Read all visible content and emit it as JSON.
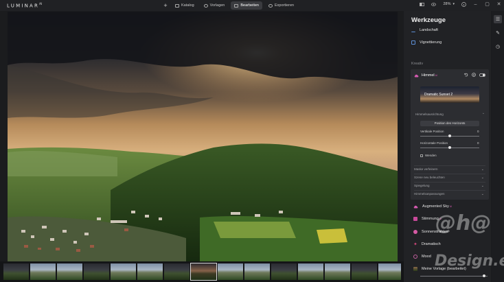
{
  "app": {
    "logo": "LUMINAR",
    "logo_version": "AI"
  },
  "nav": {
    "tabs": [
      {
        "label": "Katalog"
      },
      {
        "label": "Vorlagen"
      },
      {
        "label": "Bearbeiten"
      },
      {
        "label": "Exportieren"
      }
    ],
    "active_tab": "Bearbeiten",
    "zoom": "28%"
  },
  "panel": {
    "title": "Werkzeuge",
    "tools_top": [
      {
        "label": "Landschaft",
        "icon": "landscape-icon"
      },
      {
        "label": "Vignettierung",
        "icon": "vignette-icon"
      }
    ],
    "section_kreativ": "Kreativ",
    "sky": {
      "name": "Himmel",
      "badge": "AI",
      "preset": "Dramatic Sunset 2",
      "group_title": "Himmelsausrichtung",
      "horizon_button": "Position des Horizonts",
      "sliders": [
        {
          "label": "Vertikale Position",
          "value": "0"
        },
        {
          "label": "Horizontale Position",
          "value": "0"
        }
      ],
      "checkbox": "Wenden",
      "folds": [
        "Maske verfeinern",
        "Szene neu beleuchten",
        "Spiegelung",
        "Himmelsanpassungen"
      ]
    },
    "tools_bottom": [
      {
        "label": "Augmented Sky",
        "badge": "AI",
        "icon": "augmented-sky-icon",
        "color": "#d45ab0"
      },
      {
        "label": "Stimmung",
        "badge": "AI",
        "icon": "mood-icon",
        "color": "#c8499a"
      },
      {
        "label": "Sonnenstrahlen",
        "icon": "sunrays-icon",
        "color": "#d65aa4"
      },
      {
        "label": "Dramatisch",
        "icon": "dramatic-icon",
        "color": "#d6497e"
      },
      {
        "label": "Mood",
        "icon": "mood-lut-icon",
        "color": "#c45fa0"
      }
    ],
    "custom_preset": "Meine Vorlage (bearbeitet)"
  },
  "filmstrip": {
    "count": 15,
    "active_index": 7
  },
  "watermark": {
    "line1": "@h@",
    "line2": "Design.eu"
  },
  "colors": {
    "accent": "#6f58c9",
    "panel_bg": "#212225",
    "highlight_box": "#2c2d31"
  }
}
